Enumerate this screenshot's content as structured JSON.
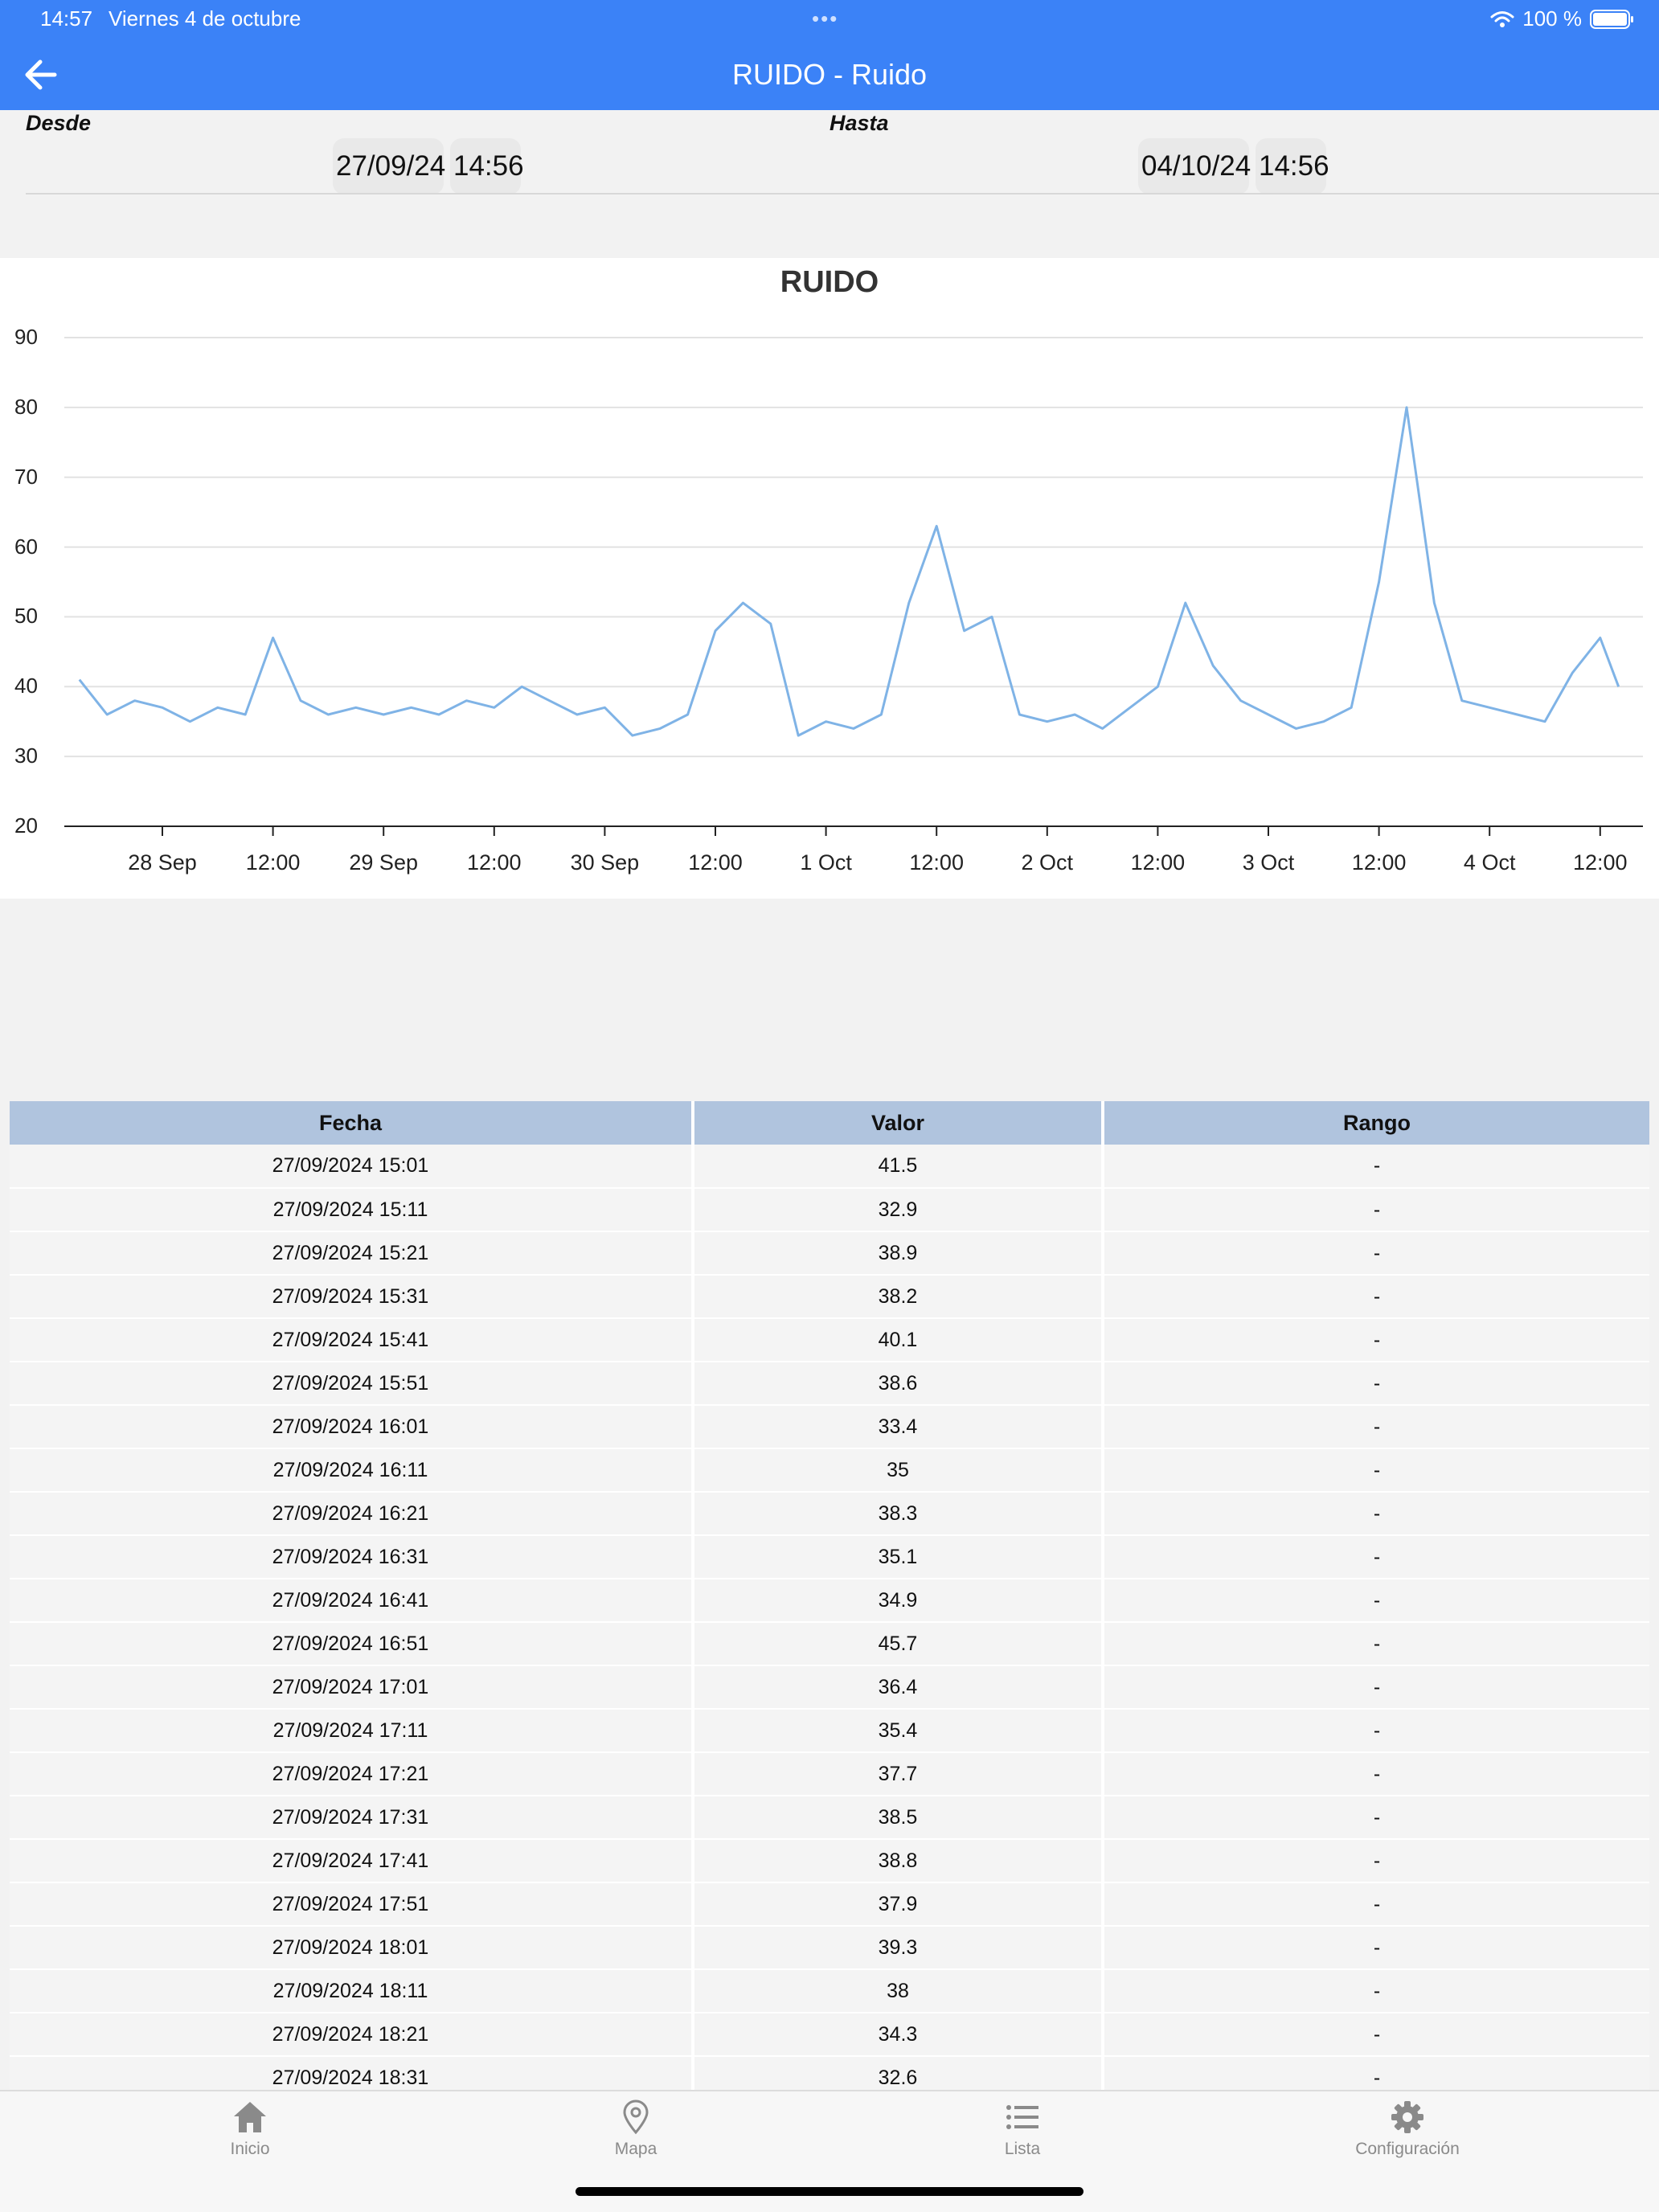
{
  "status_bar": {
    "time": "14:57",
    "date": "Viernes 4 de octubre",
    "battery": "100 %"
  },
  "header": {
    "title": "RUIDO - Ruido",
    "color": "#3b82f7"
  },
  "range": {
    "from_label": "Desde",
    "from_date": "27/09/24",
    "from_time": "14:56",
    "to_label": "Hasta",
    "to_date": "04/10/24",
    "to_time": "14:56"
  },
  "chart_data": {
    "type": "line",
    "title": "RUIDO",
    "xlabel": "",
    "ylabel": "",
    "ylim": [
      20,
      90
    ],
    "yticks": [
      20,
      30,
      40,
      50,
      60,
      70,
      80,
      90
    ],
    "xlim": [
      "27/09/2024 14:56",
      "04/10/2024 14:56"
    ],
    "xticks": [
      {
        "t": "28/09/2024 00:00",
        "label": "28 Sep"
      },
      {
        "t": "28/09/2024 12:00",
        "label": "12:00"
      },
      {
        "t": "29/09/2024 00:00",
        "label": "29 Sep"
      },
      {
        "t": "29/09/2024 12:00",
        "label": "12:00"
      },
      {
        "t": "30/09/2024 00:00",
        "label": "30 Sep"
      },
      {
        "t": "30/09/2024 12:00",
        "label": "12:00"
      },
      {
        "t": "01/10/2024 00:00",
        "label": "1 Oct"
      },
      {
        "t": "01/10/2024 12:00",
        "label": "12:00"
      },
      {
        "t": "02/10/2024 00:00",
        "label": "2 Oct"
      },
      {
        "t": "02/10/2024 12:00",
        "label": "12:00"
      },
      {
        "t": "03/10/2024 00:00",
        "label": "3 Oct"
      },
      {
        "t": "03/10/2024 12:00",
        "label": "12:00"
      },
      {
        "t": "04/10/2024 00:00",
        "label": "4 Oct"
      },
      {
        "t": "04/10/2024 12:00",
        "label": "12:00"
      }
    ],
    "grid": true,
    "line_color": "#7fb3e6",
    "series": [
      {
        "x": [
          "27/09/2024 15:00",
          "27/09/2024 18:00",
          "27/09/2024 21:00",
          "28/09/2024 00:00",
          "28/09/2024 03:00",
          "28/09/2024 06:00",
          "28/09/2024 09:00",
          "28/09/2024 12:00",
          "28/09/2024 15:00",
          "28/09/2024 18:00",
          "28/09/2024 21:00",
          "29/09/2024 00:00",
          "29/09/2024 03:00",
          "29/09/2024 06:00",
          "29/09/2024 09:00",
          "29/09/2024 12:00",
          "29/09/2024 15:00",
          "29/09/2024 18:00",
          "29/09/2024 21:00",
          "30/09/2024 00:00",
          "30/09/2024 03:00",
          "30/09/2024 06:00",
          "30/09/2024 09:00",
          "30/09/2024 12:00",
          "30/09/2024 15:00",
          "30/09/2024 18:00",
          "30/09/2024 21:00",
          "01/10/2024 00:00",
          "01/10/2024 03:00",
          "01/10/2024 06:00",
          "01/10/2024 09:00",
          "01/10/2024 12:00",
          "01/10/2024 15:00",
          "01/10/2024 18:00",
          "01/10/2024 21:00",
          "02/10/2024 00:00",
          "02/10/2024 03:00",
          "02/10/2024 06:00",
          "02/10/2024 09:00",
          "02/10/2024 12:00",
          "02/10/2024 15:00",
          "02/10/2024 18:00",
          "02/10/2024 21:00",
          "03/10/2024 00:00",
          "03/10/2024 03:00",
          "03/10/2024 06:00",
          "03/10/2024 09:00",
          "03/10/2024 12:00",
          "03/10/2024 15:00",
          "03/10/2024 18:00",
          "03/10/2024 21:00",
          "04/10/2024 00:00",
          "04/10/2024 03:00",
          "04/10/2024 06:00",
          "04/10/2024 09:00",
          "04/10/2024 12:00",
          "04/10/2024 14:00"
        ],
        "y": [
          41,
          36,
          38,
          37,
          35,
          37,
          36,
          47,
          38,
          36,
          37,
          36,
          37,
          36,
          38,
          37,
          40,
          38,
          36,
          37,
          33,
          34,
          36,
          48,
          52,
          49,
          33,
          35,
          34,
          36,
          52,
          63,
          48,
          50,
          36,
          35,
          36,
          34,
          37,
          40,
          52,
          43,
          38,
          36,
          34,
          35,
          37,
          55,
          80,
          52,
          38,
          37,
          36,
          35,
          42,
          47,
          40
        ]
      }
    ]
  },
  "table": {
    "headers": [
      "Fecha",
      "Valor",
      "Rango"
    ],
    "rows": [
      [
        "27/09/2024 15:01",
        "41.5",
        "-"
      ],
      [
        "27/09/2024 15:11",
        "32.9",
        "-"
      ],
      [
        "27/09/2024 15:21",
        "38.9",
        "-"
      ],
      [
        "27/09/2024 15:31",
        "38.2",
        "-"
      ],
      [
        "27/09/2024 15:41",
        "40.1",
        "-"
      ],
      [
        "27/09/2024 15:51",
        "38.6",
        "-"
      ],
      [
        "27/09/2024 16:01",
        "33.4",
        "-"
      ],
      [
        "27/09/2024 16:11",
        "35",
        "-"
      ],
      [
        "27/09/2024 16:21",
        "38.3",
        "-"
      ],
      [
        "27/09/2024 16:31",
        "35.1",
        "-"
      ],
      [
        "27/09/2024 16:41",
        "34.9",
        "-"
      ],
      [
        "27/09/2024 16:51",
        "45.7",
        "-"
      ],
      [
        "27/09/2024 17:01",
        "36.4",
        "-"
      ],
      [
        "27/09/2024 17:11",
        "35.4",
        "-"
      ],
      [
        "27/09/2024 17:21",
        "37.7",
        "-"
      ],
      [
        "27/09/2024 17:31",
        "38.5",
        "-"
      ],
      [
        "27/09/2024 17:41",
        "38.8",
        "-"
      ],
      [
        "27/09/2024 17:51",
        "37.9",
        "-"
      ],
      [
        "27/09/2024 18:01",
        "39.3",
        "-"
      ],
      [
        "27/09/2024 18:11",
        "38",
        "-"
      ],
      [
        "27/09/2024 18:21",
        "34.3",
        "-"
      ],
      [
        "27/09/2024 18:31",
        "32.6",
        "-"
      ]
    ]
  },
  "tabbar": {
    "tabs": [
      {
        "label": "Inicio",
        "icon": "home-icon"
      },
      {
        "label": "Mapa",
        "icon": "map-pin-icon"
      },
      {
        "label": "Lista",
        "icon": "list-icon"
      },
      {
        "label": "Configuración",
        "icon": "gear-icon"
      }
    ]
  }
}
